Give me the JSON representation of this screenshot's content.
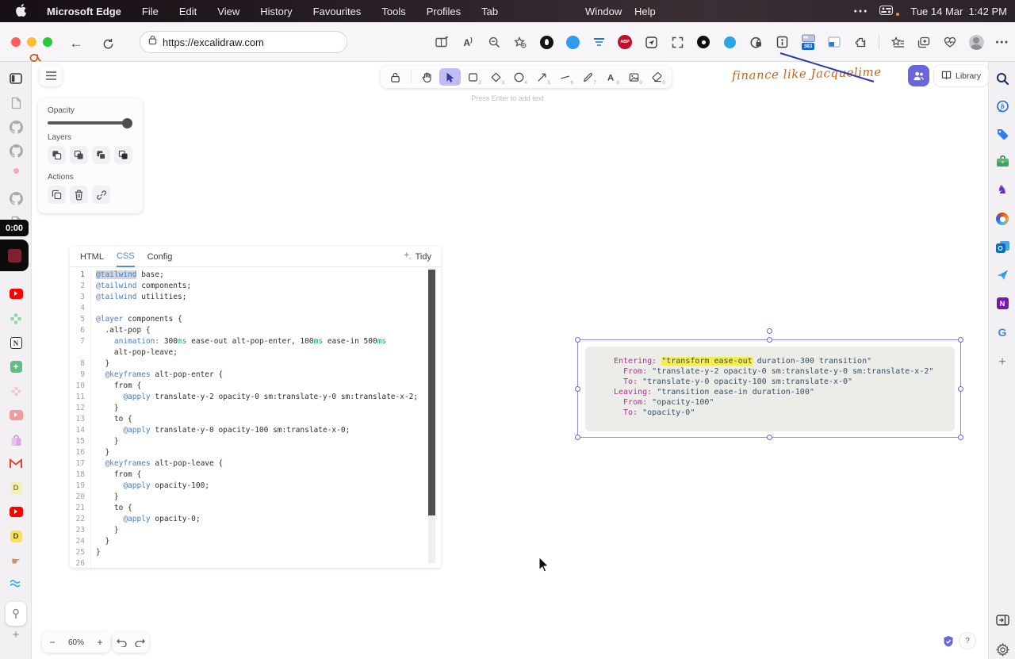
{
  "menubar": {
    "app_name": "Microsoft Edge",
    "items": [
      "File",
      "Edit",
      "View",
      "History",
      "Favourites",
      "Tools",
      "Profiles",
      "Tab"
    ],
    "window_label": "Window",
    "help_label": "Help",
    "clock": "Tue 14 Mar  1:42 PM"
  },
  "browser": {
    "url": "https://excalidraw.com",
    "tab_counter_badge": "383",
    "adblock_label": "ABP",
    "toolbar_icons": [
      "split-screen",
      "read-aloud",
      "zoom-out",
      "favorites-star",
      "dark-circle-extension",
      "blue-circle-extension",
      "filter-extension",
      "adblock-plus-extension",
      "send-page-extension",
      "fullscreen-extension",
      "black-dot-extension",
      "blue-dot-extension",
      "privacy-lock-extension",
      "reader-extension",
      "tab-counter-extension",
      "split-window-extension",
      "puzzle-extension",
      "separator",
      "favorites-list",
      "collections",
      "browser-essentials",
      "profile-avatar",
      "more-menu"
    ]
  },
  "recording": {
    "timer": "0:00"
  },
  "dock": {
    "items": [
      "vertical-tabs",
      "page",
      "github",
      "github",
      "pink-dot",
      "github",
      "page",
      "youtube",
      "flower",
      "notion",
      "green-plus",
      "flower-faded",
      "youtube-pale",
      "bag",
      "gmail",
      "d-pale",
      "youtube",
      "d-bright",
      "hand-pointer",
      "waves",
      "pin-button",
      "add"
    ]
  },
  "edge_sidebar": {
    "items": [
      "search",
      "bing-chat",
      "shopping-tag",
      "toolbox",
      "games",
      "microsoft-365",
      "outlook",
      "drop",
      "onenote",
      "google",
      "add-app"
    ]
  },
  "excalidraw": {
    "panel": {
      "opacity_label": "Opacity",
      "layers_label": "Layers",
      "actions_label": "Actions"
    },
    "tools": [
      {
        "name": "lock",
        "shortcut": ""
      },
      {
        "name": "hand",
        "shortcut": ""
      },
      {
        "name": "selection",
        "shortcut": "1",
        "active": true
      },
      {
        "name": "rectangle",
        "shortcut": "2"
      },
      {
        "name": "diamond",
        "shortcut": "3"
      },
      {
        "name": "ellipse",
        "shortcut": "4"
      },
      {
        "name": "arrow",
        "shortcut": "5"
      },
      {
        "name": "line",
        "shortcut": "6"
      },
      {
        "name": "draw",
        "shortcut": "7"
      },
      {
        "name": "text",
        "shortcut": "8"
      },
      {
        "name": "image",
        "shortcut": "9"
      },
      {
        "name": "eraser",
        "shortcut": "0"
      }
    ],
    "canvas_hint": "Press Enter to add text",
    "library_label": "Library",
    "annotation": "finance like Jacquelime",
    "help_label": "?",
    "footer": {
      "zoom_out": "−",
      "zoom_level": "60%",
      "zoom_in": "+"
    }
  },
  "editor": {
    "tabs": [
      "HTML",
      "CSS",
      "Config"
    ],
    "active_tab": "CSS",
    "tidy_label": "Tidy",
    "rows": [
      {
        "n": "1",
        "t": [
          [
            "@tailwind",
            "at sel"
          ],
          [
            " base;",
            "p"
          ]
        ]
      },
      {
        "n": "2",
        "t": [
          [
            "@tailwind",
            "at"
          ],
          [
            " components;",
            "p"
          ]
        ]
      },
      {
        "n": "3",
        "t": [
          [
            "@tailwind",
            "at"
          ],
          [
            " utilities;",
            "p"
          ]
        ]
      },
      {
        "n": "4",
        "t": []
      },
      {
        "n": "5",
        "t": [
          [
            "@layer",
            "at"
          ],
          [
            " components {",
            "p"
          ]
        ]
      },
      {
        "n": "6",
        "t": [
          [
            "  .alt-pop {",
            "p"
          ]
        ]
      },
      {
        "n": "7",
        "t": [
          [
            "    ",
            "p"
          ],
          [
            "animation:",
            "at"
          ],
          [
            " 300",
            "p"
          ],
          [
            "ms",
            "unit"
          ],
          [
            " ease-out alt-pop-enter, 100",
            "p"
          ],
          [
            "ms",
            "unit"
          ],
          [
            " ease-in 500",
            "p"
          ],
          [
            "ms",
            "unit"
          ]
        ]
      },
      {
        "n": "",
        "t": [
          [
            "    alt-pop-leave;",
            "p"
          ]
        ]
      },
      {
        "n": "8",
        "t": [
          [
            "  }",
            "p"
          ]
        ]
      },
      {
        "n": "9",
        "t": [
          [
            "  ",
            "p"
          ],
          [
            "@keyframes",
            "at"
          ],
          [
            " alt-pop-enter {",
            "p"
          ]
        ]
      },
      {
        "n": "10",
        "t": [
          [
            "    from {",
            "p"
          ]
        ]
      },
      {
        "n": "11",
        "t": [
          [
            "      ",
            "p"
          ],
          [
            "@apply",
            "at"
          ],
          [
            " translate-y-2 opacity-0 sm:translate-y-0 sm:translate-x-2;",
            "p"
          ]
        ]
      },
      {
        "n": "12",
        "t": [
          [
            "    }",
            "p"
          ]
        ]
      },
      {
        "n": "13",
        "t": [
          [
            "    to {",
            "p"
          ]
        ]
      },
      {
        "n": "14",
        "t": [
          [
            "      ",
            "p"
          ],
          [
            "@apply",
            "at"
          ],
          [
            " translate-y-0 opacity-100 sm:translate-x-0;",
            "p"
          ]
        ]
      },
      {
        "n": "15",
        "t": [
          [
            "    }",
            "p"
          ]
        ]
      },
      {
        "n": "16",
        "t": [
          [
            "  }",
            "p"
          ]
        ]
      },
      {
        "n": "17",
        "t": [
          [
            "  ",
            "p"
          ],
          [
            "@keyframes",
            "at"
          ],
          [
            " alt-pop-leave {",
            "p"
          ]
        ]
      },
      {
        "n": "18",
        "t": [
          [
            "    from {",
            "p"
          ]
        ]
      },
      {
        "n": "19",
        "t": [
          [
            "      ",
            "p"
          ],
          [
            "@apply",
            "at"
          ],
          [
            " opacity-100;",
            "p"
          ]
        ]
      },
      {
        "n": "20",
        "t": [
          [
            "    }",
            "p"
          ]
        ]
      },
      {
        "n": "21",
        "t": [
          [
            "    to {",
            "p"
          ]
        ]
      },
      {
        "n": "22",
        "t": [
          [
            "      ",
            "p"
          ],
          [
            "@apply",
            "at"
          ],
          [
            " opacity-0;",
            "p"
          ]
        ]
      },
      {
        "n": "23",
        "t": [
          [
            "    }",
            "p"
          ]
        ]
      },
      {
        "n": "24",
        "t": [
          [
            "  }",
            "p"
          ]
        ]
      },
      {
        "n": "25",
        "t": [
          [
            "}",
            "p"
          ]
        ]
      },
      {
        "n": "26",
        "t": []
      }
    ]
  },
  "embed": {
    "rows": [
      [
        [
          "Entering: ",
          "lbl"
        ],
        [
          "\"transform ease-out",
          "hl"
        ],
        [
          " duration-300 transition\"",
          "str"
        ]
      ],
      [
        [
          "  From: ",
          "lbl"
        ],
        [
          "\"translate-y-2 opacity-0 sm:translate-y-0 sm:translate-x-2\"",
          "str"
        ]
      ],
      [
        [
          "  To: ",
          "lbl"
        ],
        [
          "\"translate-y-0 opacity-100 sm:translate-x-0\"",
          "str"
        ]
      ],
      [
        [
          "Leaving: ",
          "lbl"
        ],
        [
          "\"transition ease-in duration-100\"",
          "str"
        ]
      ],
      [
        [
          "  From: ",
          "lbl"
        ],
        [
          "\"opacity-100\"",
          "str"
        ]
      ],
      [
        [
          "  To: ",
          "lbl"
        ],
        [
          "\"opacity-0\"",
          "str"
        ]
      ]
    ]
  },
  "colors": {
    "accent": "#6965db",
    "selection_highlight": "#f4ec52",
    "annotation_orange": "#c4661c",
    "arrow_blue": "#2c3ab0",
    "record_red": "#7d2133"
  }
}
